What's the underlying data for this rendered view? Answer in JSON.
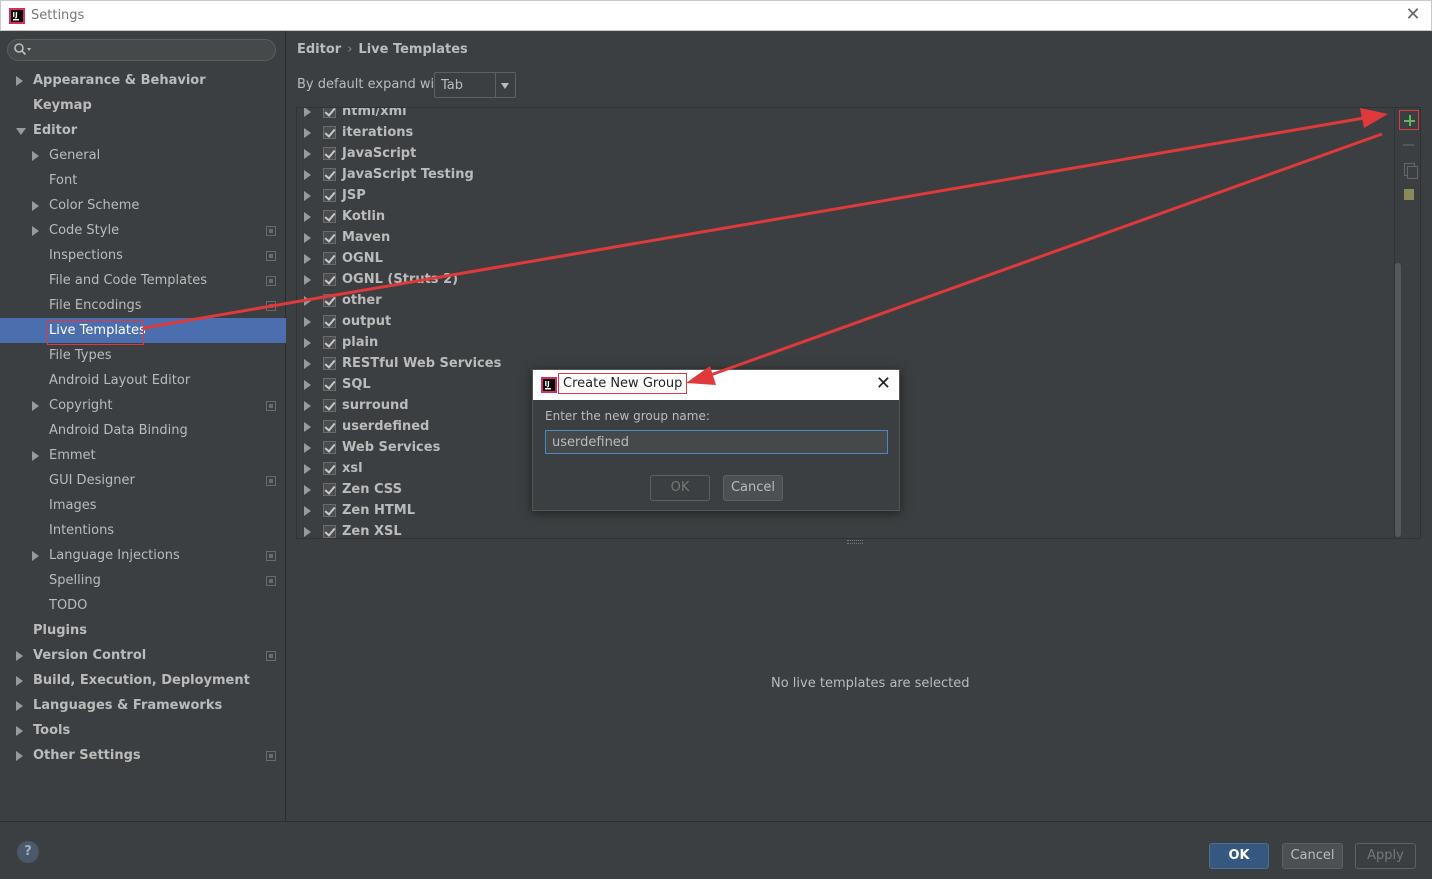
{
  "window": {
    "title": "Settings",
    "close_glyph": "✕"
  },
  "search": {
    "placeholder": "",
    "icon": "search-icon"
  },
  "sidebar": {
    "items": [
      {
        "label": "Appearance & Behavior",
        "level": 0,
        "arrow": "right",
        "bold": true,
        "project": false
      },
      {
        "label": "Keymap",
        "level": 0,
        "arrow": "none",
        "bold": true,
        "project": false
      },
      {
        "label": "Editor",
        "level": 0,
        "arrow": "down",
        "bold": true,
        "project": false
      },
      {
        "label": "General",
        "level": 1,
        "arrow": "right",
        "bold": false,
        "project": false
      },
      {
        "label": "Font",
        "level": 1,
        "arrow": "none",
        "bold": false,
        "project": false
      },
      {
        "label": "Color Scheme",
        "level": 1,
        "arrow": "right",
        "bold": false,
        "project": false
      },
      {
        "label": "Code Style",
        "level": 1,
        "arrow": "right",
        "bold": false,
        "project": true
      },
      {
        "label": "Inspections",
        "level": 1,
        "arrow": "none",
        "bold": false,
        "project": true
      },
      {
        "label": "File and Code Templates",
        "level": 1,
        "arrow": "none",
        "bold": false,
        "project": true
      },
      {
        "label": "File Encodings",
        "level": 1,
        "arrow": "none",
        "bold": false,
        "project": true
      },
      {
        "label": "Live Templates",
        "level": 1,
        "arrow": "none",
        "bold": false,
        "project": false,
        "selected": true
      },
      {
        "label": "File Types",
        "level": 1,
        "arrow": "none",
        "bold": false,
        "project": false
      },
      {
        "label": "Android Layout Editor",
        "level": 1,
        "arrow": "none",
        "bold": false,
        "project": false
      },
      {
        "label": "Copyright",
        "level": 1,
        "arrow": "right",
        "bold": false,
        "project": true
      },
      {
        "label": "Android Data Binding",
        "level": 1,
        "arrow": "none",
        "bold": false,
        "project": false
      },
      {
        "label": "Emmet",
        "level": 1,
        "arrow": "right",
        "bold": false,
        "project": false
      },
      {
        "label": "GUI Designer",
        "level": 1,
        "arrow": "none",
        "bold": false,
        "project": true
      },
      {
        "label": "Images",
        "level": 1,
        "arrow": "none",
        "bold": false,
        "project": false
      },
      {
        "label": "Intentions",
        "level": 1,
        "arrow": "none",
        "bold": false,
        "project": false
      },
      {
        "label": "Language Injections",
        "level": 1,
        "arrow": "right",
        "bold": false,
        "project": true
      },
      {
        "label": "Spelling",
        "level": 1,
        "arrow": "none",
        "bold": false,
        "project": true
      },
      {
        "label": "TODO",
        "level": 1,
        "arrow": "none",
        "bold": false,
        "project": false
      },
      {
        "label": "Plugins",
        "level": 0,
        "arrow": "none",
        "bold": true,
        "project": false
      },
      {
        "label": "Version Control",
        "level": 0,
        "arrow": "right",
        "bold": true,
        "project": true
      },
      {
        "label": "Build, Execution, Deployment",
        "level": 0,
        "arrow": "right",
        "bold": true,
        "project": false
      },
      {
        "label": "Languages & Frameworks",
        "level": 0,
        "arrow": "right",
        "bold": true,
        "project": false
      },
      {
        "label": "Tools",
        "level": 0,
        "arrow": "right",
        "bold": true,
        "project": false
      },
      {
        "label": "Other Settings",
        "level": 0,
        "arrow": "right",
        "bold": true,
        "project": true
      }
    ]
  },
  "breadcrumb": {
    "parent": "Editor",
    "separator": "›",
    "current": "Live Templates"
  },
  "expand": {
    "label": "By default expand with",
    "value": "Tab"
  },
  "templates": {
    "groups": [
      "html/xml",
      "iterations",
      "JavaScript",
      "JavaScript Testing",
      "JSP",
      "Kotlin",
      "Maven",
      "OGNL",
      "OGNL (Struts 2)",
      "other",
      "output",
      "plain",
      "RESTful Web Services",
      "SQL",
      "surround",
      "userdefined",
      "Web Services",
      "xsl",
      "Zen CSS",
      "Zen HTML",
      "Zen XSL"
    ]
  },
  "toolbar": {
    "add": "add-icon",
    "remove": "remove-icon",
    "copy": "copy-icon",
    "restore": "restore-icon"
  },
  "detail": {
    "empty_text": "No live templates are selected"
  },
  "dialog": {
    "title": "Create New Group",
    "prompt": "Enter the new group name:",
    "input_value": "userdefined",
    "ok_label": "OK",
    "cancel_label": "Cancel",
    "close_glyph": "✕"
  },
  "footer": {
    "help_label": "?",
    "ok_label": "OK",
    "cancel_label": "Cancel",
    "apply_label": "Apply"
  },
  "colors": {
    "annotation": "#e0393b",
    "selection": "#4b6eaf",
    "background": "#3c3f41"
  }
}
